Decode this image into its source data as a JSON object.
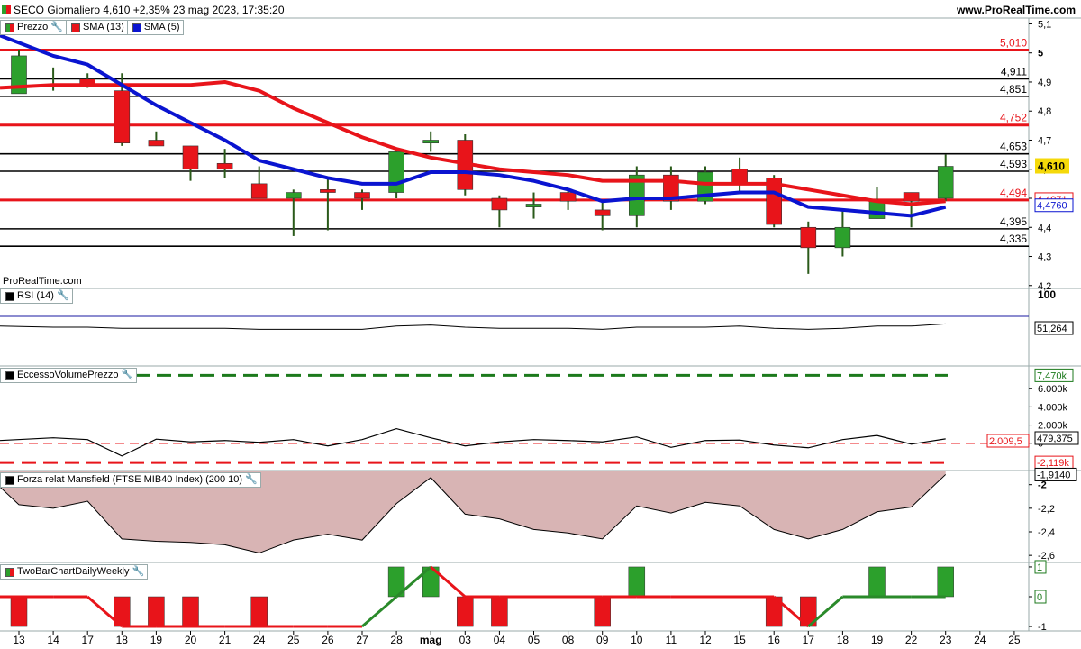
{
  "header": {
    "title": "SECO Giornaliero 4,610 +2,35% 23 mag 2023, 17:35:20",
    "site": "www.ProRealTime.com"
  },
  "watermark": "ProRealTime.com",
  "legends": {
    "price": [
      "Prezzo",
      "SMA (13)",
      "SMA (5)"
    ],
    "rsi": "RSI (14)",
    "volume": "EccessoVolumePrezzo",
    "mansfield": "Forza relat Mansfield (FTSE MIB40 Index) (200 10)",
    "twobar": "TwoBarChartDailyWeekly"
  },
  "colors": {
    "up": "#2ca02c",
    "down": "#e8141a",
    "sma13": "#e8141a",
    "sma5": "#0a14d0",
    "last_price_bg": "#f5d90a"
  },
  "chart_data": [
    {
      "type": "candlestick",
      "title": "Prezzo",
      "x": [
        "13",
        "14",
        "17",
        "18",
        "19",
        "20",
        "21",
        "24",
        "25",
        "26",
        "27",
        "28",
        "mag",
        "03",
        "04",
        "05",
        "08",
        "09",
        "10",
        "11",
        "12",
        "15",
        "16",
        "17",
        "18",
        "19",
        "22",
        "23"
      ],
      "x_labels": [
        "13",
        "14",
        "17",
        "18",
        "19",
        "20",
        "21",
        "24",
        "25",
        "26",
        "27",
        "28",
        "mag",
        "03",
        "04",
        "05",
        "08",
        "09",
        "10",
        "11",
        "12",
        "15",
        "16",
        "17",
        "18",
        "19",
        "22",
        "23",
        "24",
        "25"
      ],
      "ohlc": [
        [
          4.86,
          5.01,
          4.86,
          4.99
        ],
        [
          4.89,
          4.95,
          4.87,
          4.89
        ],
        [
          4.91,
          4.93,
          4.88,
          4.89
        ],
        [
          4.87,
          4.93,
          4.68,
          4.69
        ],
        [
          4.7,
          4.73,
          4.68,
          4.68
        ],
        [
          4.68,
          4.68,
          4.56,
          4.6
        ],
        [
          4.62,
          4.67,
          4.57,
          4.6
        ],
        [
          4.55,
          4.61,
          4.51,
          4.5
        ],
        [
          4.5,
          4.53,
          4.37,
          4.52
        ],
        [
          4.53,
          4.57,
          4.39,
          4.52
        ],
        [
          4.52,
          4.53,
          4.46,
          4.5
        ],
        [
          4.52,
          4.67,
          4.5,
          4.66
        ],
        [
          4.69,
          4.73,
          4.66,
          4.7
        ],
        [
          4.7,
          4.72,
          4.51,
          4.53
        ],
        [
          4.5,
          4.51,
          4.4,
          4.46
        ],
        [
          4.47,
          4.52,
          4.43,
          4.48
        ],
        [
          4.52,
          4.53,
          4.46,
          4.49
        ],
        [
          4.46,
          4.49,
          4.39,
          4.44
        ],
        [
          4.44,
          4.61,
          4.4,
          4.58
        ],
        [
          4.58,
          4.61,
          4.46,
          4.49
        ],
        [
          4.49,
          4.61,
          4.48,
          4.59
        ],
        [
          4.6,
          4.64,
          4.52,
          4.55
        ],
        [
          4.57,
          4.58,
          4.4,
          4.41
        ],
        [
          4.4,
          4.42,
          4.24,
          4.33
        ],
        [
          4.33,
          4.46,
          4.3,
          4.4
        ],
        [
          4.43,
          4.54,
          4.46,
          4.49
        ],
        [
          4.52,
          4.51,
          4.4,
          4.49
        ],
        [
          4.5,
          4.65,
          4.49,
          4.61
        ]
      ],
      "series": [
        {
          "name": "SMA (13)",
          "values": [
            4.88,
            4.89,
            4.89,
            4.89,
            4.89,
            4.89,
            4.9,
            4.87,
            4.81,
            4.76,
            4.71,
            4.67,
            4.64,
            4.62,
            4.6,
            4.59,
            4.58,
            4.56,
            4.56,
            4.56,
            4.55,
            4.55,
            4.55,
            4.53,
            4.51,
            4.49,
            4.48,
            4.49
          ]
        },
        {
          "name": "SMA (5)",
          "values": [
            5.06,
            4.99,
            4.96,
            4.89,
            4.82,
            4.76,
            4.7,
            4.63,
            4.6,
            4.57,
            4.55,
            4.55,
            4.59,
            4.59,
            4.58,
            4.56,
            4.53,
            4.49,
            4.5,
            4.5,
            4.51,
            4.52,
            4.52,
            4.47,
            4.46,
            4.45,
            4.44,
            4.47
          ]
        }
      ],
      "hlines": [
        {
          "value": 5.01,
          "label": "5,010",
          "color": "red"
        },
        {
          "value": 4.911,
          "label": "4,911",
          "color": "black"
        },
        {
          "value": 4.851,
          "label": "4,851",
          "color": "black"
        },
        {
          "value": 4.752,
          "label": "4,752",
          "color": "red"
        },
        {
          "value": 4.653,
          "label": "4,653",
          "color": "black"
        },
        {
          "value": 4.593,
          "label": "4,593",
          "color": "black"
        },
        {
          "value": 4.494,
          "label": "4,494",
          "color": "red"
        },
        {
          "value": 4.395,
          "label": "4,395",
          "color": "black"
        },
        {
          "value": 4.335,
          "label": "4,335",
          "color": "black"
        }
      ],
      "yticks": [
        "5,1",
        "5",
        "4,9",
        "4,8",
        "4,7",
        "4,6",
        "4,5",
        "4,4",
        "4,3",
        "4,2"
      ],
      "ylim": [
        4.19,
        5.12
      ],
      "last_values": {
        "price": "4,610",
        "sma13": "4,4971",
        "sma5": "4,4760"
      }
    },
    {
      "type": "line",
      "title": "RSI (14)",
      "values": [
        51,
        50,
        50,
        49,
        49,
        49,
        49,
        48,
        48,
        48,
        48,
        51,
        52,
        50,
        49,
        49,
        49,
        48,
        50,
        50,
        50,
        51,
        49,
        48,
        49,
        51,
        51,
        53
      ],
      "hline": 100,
      "yticks": [
        "100"
      ],
      "ylim": [
        0,
        100
      ],
      "last_value": "51,264"
    },
    {
      "type": "line",
      "title": "EccessoVolumePrezzo",
      "values": [
        300,
        600,
        400,
        -1400,
        450,
        150,
        300,
        100,
        400,
        -300,
        400,
        1600,
        600,
        -300,
        150,
        400,
        300,
        150,
        700,
        -450,
        300,
        350,
        -200,
        -500,
        400,
        850,
        -100,
        479.375
      ],
      "hlines": [
        {
          "value": 7470,
          "label": "7,470k",
          "color": "green",
          "dashed": true
        },
        {
          "value": 479.375,
          "label": "479,375",
          "color": "black"
        },
        {
          "value": 0,
          "label": "2.009,5",
          "color": "red",
          "dashed": true
        },
        {
          "value": -2119,
          "label": "-2,119k",
          "color": "red",
          "dashed": true
        }
      ],
      "yticks": [
        "6.000k",
        "4.000k",
        "2.000k",
        "0"
      ],
      "ylim": [
        -3000,
        8500
      ]
    },
    {
      "type": "area",
      "title": "Forza relat Mansfield (FTSE MIB40 Index) (200 10)",
      "values": [
        -2.02,
        -2.17,
        -2.2,
        -2.14,
        -2.46,
        -2.48,
        -2.49,
        -2.51,
        -2.58,
        -2.47,
        -2.42,
        -2.47,
        -2.16,
        -1.94,
        -2.25,
        -2.29,
        -2.38,
        -2.41,
        -2.46,
        -2.18,
        -2.24,
        -2.15,
        -2.18,
        -2.38,
        -2.46,
        -2.38,
        -2.23,
        -2.19,
        -1.914
      ],
      "yticks": [
        "-2",
        "-2,2",
        "-2,4",
        "-2,6"
      ],
      "ylim": [
        -2.66,
        -1.88
      ],
      "last_value": "-1,9140"
    },
    {
      "type": "bar",
      "title": "TwoBarChartDailyWeekly",
      "values": [
        -1,
        0,
        0,
        -1,
        -1,
        -1,
        0,
        -1,
        0,
        0,
        0,
        1,
        1,
        -1,
        -1,
        0,
        0,
        -1,
        1,
        0,
        0,
        0,
        -1,
        -1,
        0,
        1,
        0,
        1
      ],
      "weekly": [
        0,
        0,
        0,
        -1,
        -1,
        -1,
        -1,
        -1,
        -1,
        -1,
        -1,
        0,
        1,
        0,
        0,
        0,
        0,
        0,
        0,
        0,
        0,
        0,
        0,
        -1,
        0,
        0,
        0,
        0
      ],
      "yticks": [
        "1",
        "0",
        "-1"
      ],
      "ylim": [
        -1.15,
        1.15
      ]
    }
  ]
}
